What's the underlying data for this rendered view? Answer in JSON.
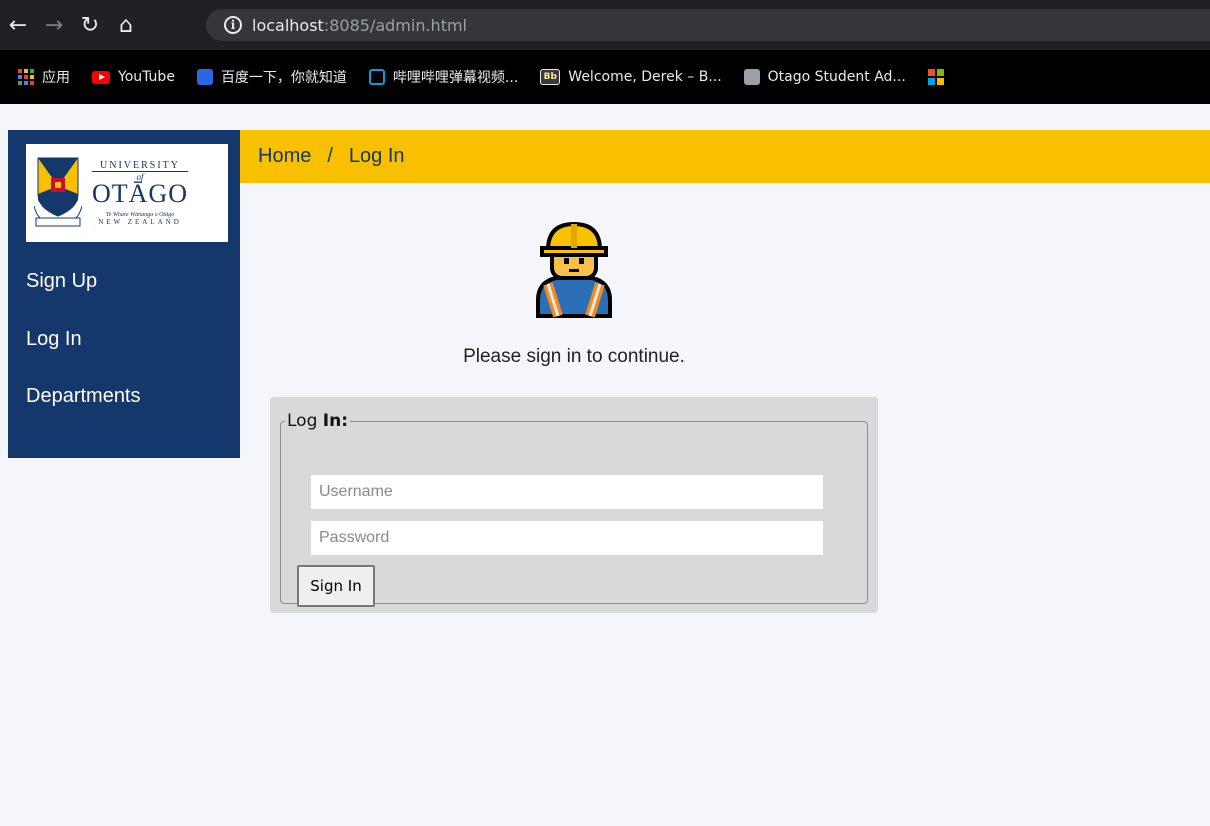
{
  "browser": {
    "url_host": "localhost",
    "url_path": ":8085/admin.html",
    "bookmarks": [
      {
        "label": "应用",
        "icon": "apps-grid-icon"
      },
      {
        "label": "YouTube",
        "icon": "youtube-icon"
      },
      {
        "label": "百度一下，你就知道",
        "icon": "baidu-paw-icon"
      },
      {
        "label": "哔哩哔哩弹幕视频...",
        "icon": "bilibili-tv-icon"
      },
      {
        "label": "Welcome, Derek – B...",
        "icon": "blackboard-icon"
      },
      {
        "label": "Otago Student Ad...",
        "icon": "globe-icon"
      },
      {
        "label": "",
        "icon": "microsoft-icon"
      }
    ]
  },
  "logo": {
    "line1": "UNIVERSITY",
    "line2": "of",
    "line3": "OTĀGO",
    "line4": "Te Whare Wānanga o Otāgo",
    "line5": "NEW ZEALAND"
  },
  "sidebar": {
    "items": [
      {
        "label": "Sign Up"
      },
      {
        "label": "Log In"
      },
      {
        "label": "Departments"
      }
    ]
  },
  "breadcrumb": {
    "home": "Home",
    "separator": "/",
    "current": "Log In"
  },
  "main": {
    "prompt": "Please sign in to continue.",
    "form": {
      "legend_prefix": "Log ",
      "legend_bold": "In:",
      "username_placeholder": "Username",
      "password_placeholder": "Password",
      "submit_label": "Sign In"
    }
  },
  "colors": {
    "navy": "#14386b",
    "gold": "#f9c000",
    "page_bg": "#f5f6fb"
  }
}
